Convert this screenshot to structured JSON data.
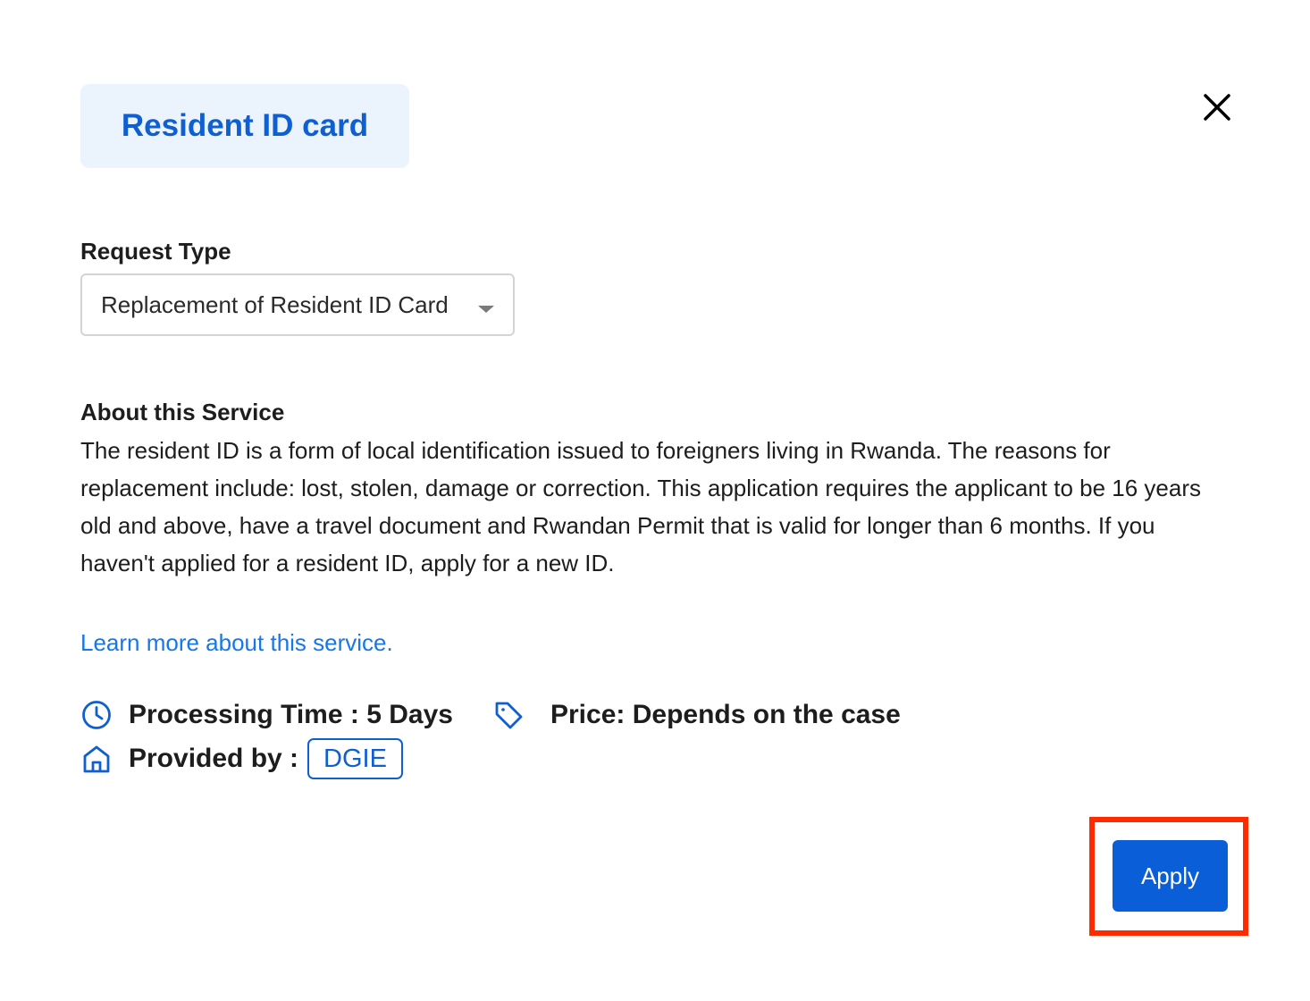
{
  "header": {
    "title": "Resident ID card"
  },
  "close_icon": "close-icon",
  "request": {
    "label": "Request Type",
    "selected": "Replacement of Resident ID Card"
  },
  "about": {
    "heading": "About this Service",
    "text": "The resident ID is a form of local identification issued to foreigners living in Rwanda. The reasons for replacement include: lost, stolen, damage or correction. This application requires the applicant to be 16 years old and above, have a travel document and Rwandan Permit that is valid for longer than 6 months. If you haven't applied for a resident ID, apply for a new ID."
  },
  "learn_more": "Learn more about this service.",
  "meta": {
    "processing": "Processing Time : 5 Days",
    "price": "Price: Depends on the case",
    "provided_by_label": "Provided by :",
    "provider": "DGIE"
  },
  "actions": {
    "apply_label": "Apply"
  },
  "colors": {
    "accent": "#0f5fd1",
    "link": "#1677e8",
    "chip_bg": "#ebf3fd",
    "apply_bg": "#0a5fd8",
    "highlight": "#ff2a00"
  }
}
